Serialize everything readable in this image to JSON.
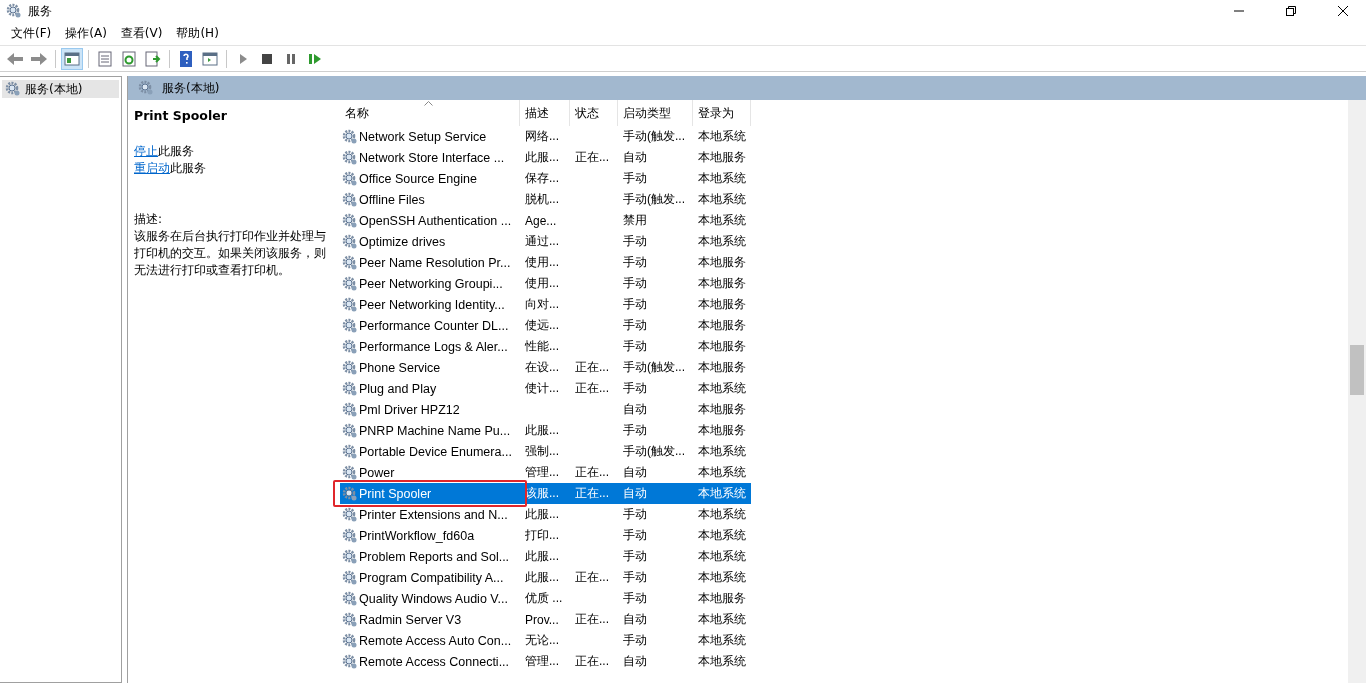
{
  "window": {
    "title": "服务"
  },
  "menu": [
    "文件(F)",
    "操作(A)",
    "查看(V)",
    "帮助(H)"
  ],
  "toolbar": [
    {
      "kind": "back",
      "selected": false
    },
    {
      "kind": "forward",
      "selected": false
    },
    {
      "kind": "tree",
      "selected": true
    },
    {
      "kind": "properties",
      "selected": false
    },
    {
      "kind": "refresh",
      "selected": false
    },
    {
      "kind": "export",
      "selected": false
    },
    {
      "kind": "help",
      "selected": false
    },
    {
      "kind": "console",
      "selected": false
    },
    {
      "kind": "start",
      "selected": false
    },
    {
      "kind": "stop",
      "selected": false
    },
    {
      "kind": "pause",
      "selected": false
    },
    {
      "kind": "resume",
      "selected": false
    }
  ],
  "tree": {
    "items": [
      {
        "label": "服务(本地)",
        "selected": true
      }
    ]
  },
  "panel": {
    "title": "服务(本地)"
  },
  "details": {
    "name": "Print Spooler",
    "actions": [
      {
        "link": "停止",
        "text": "此服务"
      },
      {
        "link": "重启动",
        "text": "此服务"
      }
    ],
    "description_label": "描述:",
    "description": "该服务在后台执行打印作业并处理与打印机的交互。如果关闭该服务，则无法进行打印或查看打印机。"
  },
  "table": {
    "columns": [
      "名称",
      "描述",
      "状态",
      "启动类型",
      "登录为"
    ],
    "rows": [
      {
        "name": "Network Setup Service",
        "desc": "网络...",
        "status": "",
        "startup": "手动(触发...",
        "logon": "本地系统",
        "selected": false,
        "highlighted": false
      },
      {
        "name": "Network Store Interface ...",
        "desc": "此服...",
        "status": "正在...",
        "startup": "自动",
        "logon": "本地服务",
        "selected": false,
        "highlighted": false
      },
      {
        "name": "Office  Source Engine",
        "desc": "保存...",
        "status": "",
        "startup": "手动",
        "logon": "本地系统",
        "selected": false,
        "highlighted": false
      },
      {
        "name": "Offline Files",
        "desc": "脱机...",
        "status": "",
        "startup": "手动(触发...",
        "logon": "本地系统",
        "selected": false,
        "highlighted": false
      },
      {
        "name": "OpenSSH Authentication ...",
        "desc": "Age...",
        "status": "",
        "startup": "禁用",
        "logon": "本地系统",
        "selected": false,
        "highlighted": false
      },
      {
        "name": "Optimize drives",
        "desc": "通过...",
        "status": "",
        "startup": "手动",
        "logon": "本地系统",
        "selected": false,
        "highlighted": false
      },
      {
        "name": "Peer Name Resolution Pr...",
        "desc": "使用...",
        "status": "",
        "startup": "手动",
        "logon": "本地服务",
        "selected": false,
        "highlighted": false
      },
      {
        "name": "Peer Networking Groupi...",
        "desc": "使用...",
        "status": "",
        "startup": "手动",
        "logon": "本地服务",
        "selected": false,
        "highlighted": false
      },
      {
        "name": "Peer Networking Identity...",
        "desc": "向对...",
        "status": "",
        "startup": "手动",
        "logon": "本地服务",
        "selected": false,
        "highlighted": false
      },
      {
        "name": "Performance Counter DL...",
        "desc": "使远...",
        "status": "",
        "startup": "手动",
        "logon": "本地服务",
        "selected": false,
        "highlighted": false
      },
      {
        "name": "Performance Logs & Aler...",
        "desc": "性能...",
        "status": "",
        "startup": "手动",
        "logon": "本地服务",
        "selected": false,
        "highlighted": false
      },
      {
        "name": "Phone Service",
        "desc": "在设...",
        "status": "正在...",
        "startup": "手动(触发...",
        "logon": "本地服务",
        "selected": false,
        "highlighted": false
      },
      {
        "name": "Plug and Play",
        "desc": "使计...",
        "status": "正在...",
        "startup": "手动",
        "logon": "本地系统",
        "selected": false,
        "highlighted": false
      },
      {
        "name": "Pml Driver HPZ12",
        "desc": "",
        "status": "",
        "startup": "自动",
        "logon": "本地服务",
        "selected": false,
        "highlighted": false
      },
      {
        "name": "PNRP Machine Name Pu...",
        "desc": "此服...",
        "status": "",
        "startup": "手动",
        "logon": "本地服务",
        "selected": false,
        "highlighted": false
      },
      {
        "name": "Portable Device Enumera...",
        "desc": "强制...",
        "status": "",
        "startup": "手动(触发...",
        "logon": "本地系统",
        "selected": false,
        "highlighted": false
      },
      {
        "name": "Power",
        "desc": "管理...",
        "status": "正在...",
        "startup": "自动",
        "logon": "本地系统",
        "selected": false,
        "highlighted": false
      },
      {
        "name": "Print Spooler",
        "desc": "该服...",
        "status": "正在...",
        "startup": "自动",
        "logon": "本地系统",
        "selected": true,
        "highlighted": true
      },
      {
        "name": "Printer Extensions and N...",
        "desc": "此服...",
        "status": "",
        "startup": "手动",
        "logon": "本地系统",
        "selected": false,
        "highlighted": false
      },
      {
        "name": "PrintWorkflow_fd60a",
        "desc": "打印...",
        "status": "",
        "startup": "手动",
        "logon": "本地系统",
        "selected": false,
        "highlighted": false
      },
      {
        "name": "Problem Reports and Sol...",
        "desc": "此服...",
        "status": "",
        "startup": "手动",
        "logon": "本地系统",
        "selected": false,
        "highlighted": false
      },
      {
        "name": "Program Compatibility A...",
        "desc": "此服...",
        "status": "正在...",
        "startup": "手动",
        "logon": "本地系统",
        "selected": false,
        "highlighted": false
      },
      {
        "name": "Quality Windows Audio V...",
        "desc": "优质 ...",
        "status": "",
        "startup": "手动",
        "logon": "本地服务",
        "selected": false,
        "highlighted": false
      },
      {
        "name": "Radmin Server V3",
        "desc": "Prov...",
        "status": "正在...",
        "startup": "自动",
        "logon": "本地系统",
        "selected": false,
        "highlighted": false
      },
      {
        "name": "Remote Access Auto Con...",
        "desc": "无论...",
        "status": "",
        "startup": "手动",
        "logon": "本地系统",
        "selected": false,
        "highlighted": false
      },
      {
        "name": "Remote Access Connecti...",
        "desc": "管理...",
        "status": "正在...",
        "startup": "自动",
        "logon": "本地系统",
        "selected": false,
        "highlighted": false
      }
    ]
  }
}
